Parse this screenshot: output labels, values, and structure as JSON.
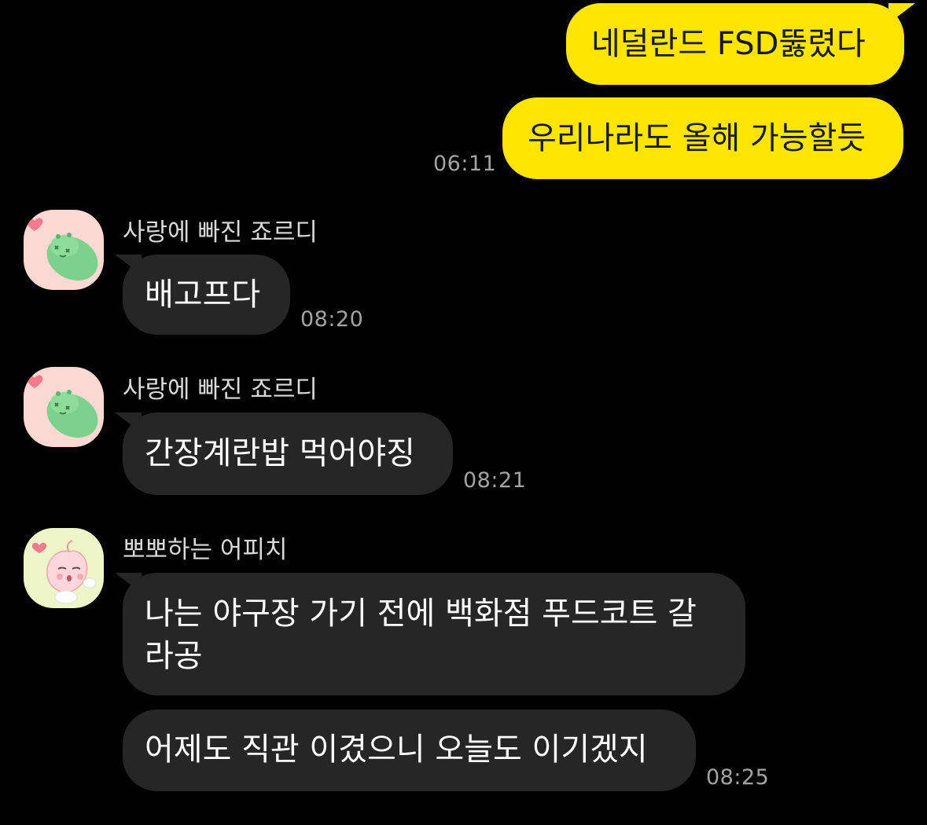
{
  "colors": {
    "background": "#000000",
    "my_bubble": "#FEE500",
    "their_bubble": "#262626",
    "timestamp": "#A3A3A3",
    "sender_name": "#D9D9D9"
  },
  "messages": {
    "m1": {
      "text": "네덜란드 FSD뚫렸다"
    },
    "m2": {
      "text": "우리나라도 올해 가능할듯",
      "time": "06:11"
    },
    "m3": {
      "sender": "사랑에 빠진 죠르디",
      "avatar_icon": "jordy-love-icon",
      "text": "배고프다",
      "time": "08:20"
    },
    "m4": {
      "sender": "사랑에 빠진 죠르디",
      "avatar_icon": "jordy-love-icon",
      "text": "간장계란밥 먹어야징",
      "time": "08:21"
    },
    "m5": {
      "sender": "뽀뽀하는 어피치",
      "avatar_icon": "apeach-kiss-icon",
      "text": "나는 야구장 가기 전에 백화점 푸드코트 갈라공"
    },
    "m6": {
      "text": "어제도 직관 이겼으니 오늘도 이기겠지",
      "time": "08:25"
    }
  }
}
